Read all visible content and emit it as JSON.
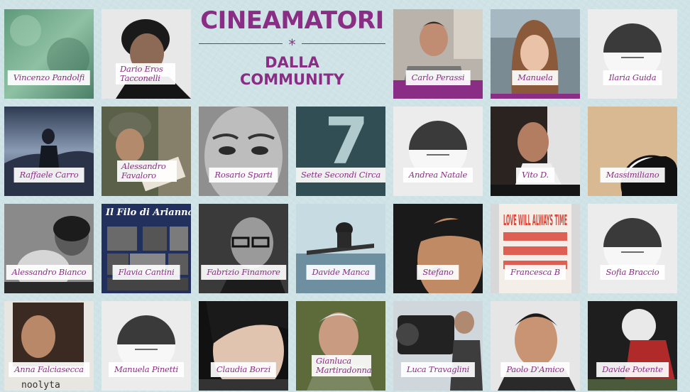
{
  "title": {
    "main": "CINEAMATORI",
    "sub_line1": "DALLA",
    "sub_line2": "COMMUNITY",
    "divider_glyph": "*"
  },
  "members": [
    {
      "name": "Vincenzo Pandolfi"
    },
    {
      "name": "Dario Eros Tacconelli"
    },
    {
      "name": "Carlo Perassi"
    },
    {
      "name": "Manuela"
    },
    {
      "name": "Ilaria Guida"
    },
    {
      "name": "Raffaele Carro"
    },
    {
      "name": "Alessandro Favaloro"
    },
    {
      "name": "Rosario Sparti"
    },
    {
      "name": "Sette Secondi Circa"
    },
    {
      "name": "Andrea Natale"
    },
    {
      "name": "Vito D."
    },
    {
      "name": "Massimiliano"
    },
    {
      "name": "Alessandro Bianco"
    },
    {
      "name": "Flavia Cantini"
    },
    {
      "name": "Fabrizio Finamore"
    },
    {
      "name": "Davide Manca"
    },
    {
      "name": "Stefano"
    },
    {
      "name": "Francesca B"
    },
    {
      "name": "Sofia Braccio"
    },
    {
      "name": "Anna Falciasecca"
    },
    {
      "name": "Manuela Pinetti"
    },
    {
      "name": "Claudia Borzi"
    },
    {
      "name": "Gianluca Martiradonna"
    },
    {
      "name": "Luca Travaglini"
    },
    {
      "name": "Paolo D'Amico"
    },
    {
      "name": "Davide Potente"
    }
  ],
  "photo_text": {
    "flavia_poster_title": "Il Filo di Arianna",
    "francesca_poster": "LOVE WILL ALWAYS TIME",
    "anna_caption": "noolyta"
  },
  "colors": {
    "accent": "#8a2d84",
    "background": "#cfe3e6"
  }
}
